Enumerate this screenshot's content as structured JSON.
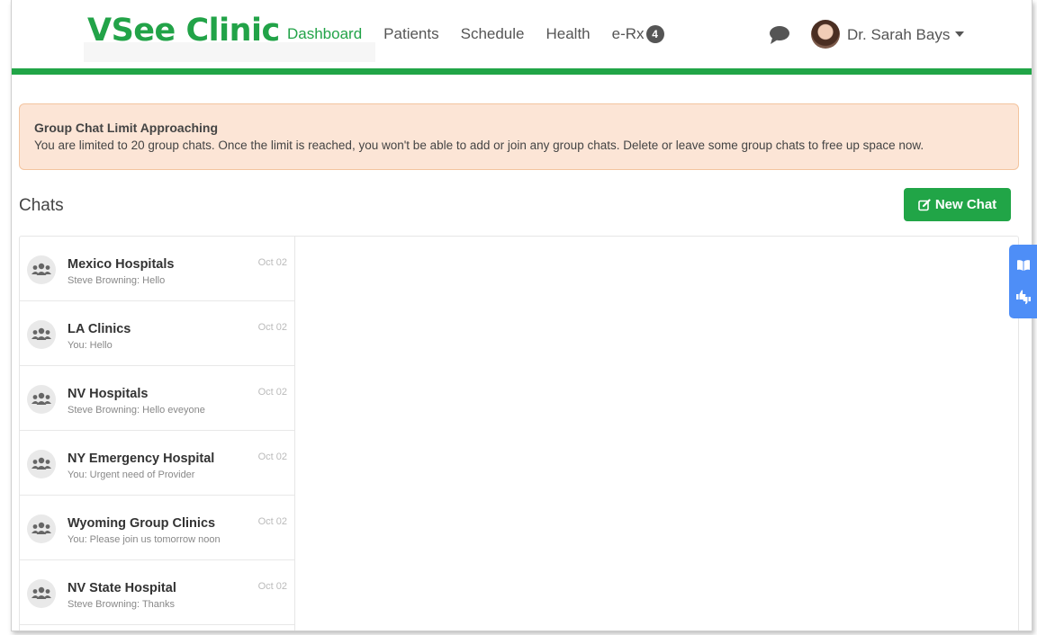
{
  "app": {
    "logo": "VSee Clinic"
  },
  "nav": {
    "items": [
      {
        "label": "Dashboard",
        "active": true
      },
      {
        "label": "Patients"
      },
      {
        "label": "Schedule"
      },
      {
        "label": "Health"
      },
      {
        "label": "e-Rx",
        "badge": "4"
      }
    ]
  },
  "user": {
    "name": "Dr. Sarah Bays"
  },
  "alert": {
    "title": "Group Chat Limit Approaching",
    "text": "You are limited to 20 group chats. Once the limit is reached, you won't be able to add or join any group chats. Delete or leave some group chats to free up space now."
  },
  "chats": {
    "title": "Chats",
    "new_chat_label": "New Chat",
    "items": [
      {
        "name": "Mexico Hospitals",
        "preview": "Steve Browning: Hello",
        "date": "Oct 02"
      },
      {
        "name": "LA Clinics",
        "preview": "You: Hello",
        "date": "Oct 02"
      },
      {
        "name": "NV Hospitals",
        "preview": "Steve Browning: Hello eveyone",
        "date": "Oct 02"
      },
      {
        "name": "NY Emergency Hospital",
        "preview": "You: Urgent need of Provider",
        "date": "Oct 02"
      },
      {
        "name": "Wyoming Group Clinics",
        "preview": "You: Please join us tomorrow noon",
        "date": "Oct 02"
      },
      {
        "name": "NV State Hospital",
        "preview": "Steve Browning: Thanks",
        "date": "Oct 02"
      }
    ]
  },
  "colors": {
    "brand_green": "#22a348",
    "alert_bg": "#fce5d6",
    "side_tab_blue": "#4e8ef7"
  },
  "icons": {
    "messages": "chat-bubble-icon",
    "group": "users-icon",
    "new_chat": "edit-icon",
    "guide": "book-icon",
    "feedback": "thumbs-icon"
  }
}
